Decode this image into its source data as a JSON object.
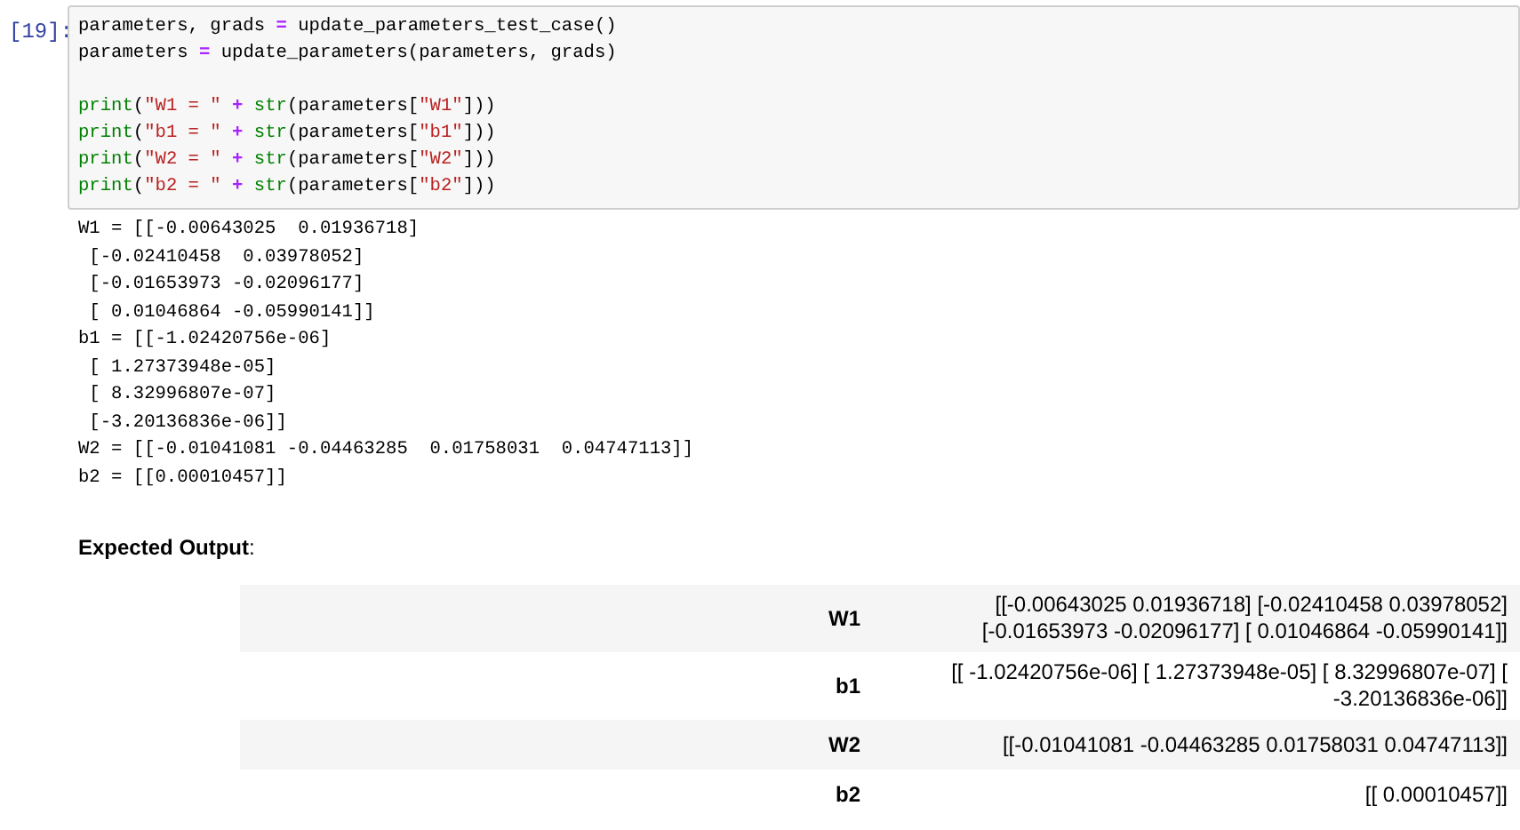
{
  "cell": {
    "prompt": "[19]:",
    "code_blocks": [
      [
        [
          {
            "kind": "name",
            "text": "parameters, grads "
          },
          {
            "kind": "op",
            "text": "="
          },
          {
            "kind": "name",
            "text": " update_parameters_test_case()"
          }
        ],
        [
          {
            "kind": "name",
            "text": "parameters "
          },
          {
            "kind": "op",
            "text": "="
          },
          {
            "kind": "name",
            "text": " update_parameters(parameters, grads)"
          }
        ]
      ],
      [
        [
          {
            "kind": "builtin",
            "text": "print"
          },
          {
            "kind": "name",
            "text": "("
          },
          {
            "kind": "string",
            "text": "\"W1 = \""
          },
          {
            "kind": "op",
            "text": " + "
          },
          {
            "kind": "builtin",
            "text": "str"
          },
          {
            "kind": "name",
            "text": "(parameters["
          },
          {
            "kind": "string",
            "text": "\"W1\""
          },
          {
            "kind": "name",
            "text": "]))"
          }
        ],
        [
          {
            "kind": "builtin",
            "text": "print"
          },
          {
            "kind": "name",
            "text": "("
          },
          {
            "kind": "string",
            "text": "\"b1 = \""
          },
          {
            "kind": "op",
            "text": " + "
          },
          {
            "kind": "builtin",
            "text": "str"
          },
          {
            "kind": "name",
            "text": "(parameters["
          },
          {
            "kind": "string",
            "text": "\"b1\""
          },
          {
            "kind": "name",
            "text": "]))"
          }
        ],
        [
          {
            "kind": "builtin",
            "text": "print"
          },
          {
            "kind": "name",
            "text": "("
          },
          {
            "kind": "string",
            "text": "\"W2 = \""
          },
          {
            "kind": "op",
            "text": " + "
          },
          {
            "kind": "builtin",
            "text": "str"
          },
          {
            "kind": "name",
            "text": "(parameters["
          },
          {
            "kind": "string",
            "text": "\"W2\""
          },
          {
            "kind": "name",
            "text": "]))"
          }
        ],
        [
          {
            "kind": "builtin",
            "text": "print"
          },
          {
            "kind": "name",
            "text": "("
          },
          {
            "kind": "string",
            "text": "\"b2 = \""
          },
          {
            "kind": "op",
            "text": " + "
          },
          {
            "kind": "builtin",
            "text": "str"
          },
          {
            "kind": "name",
            "text": "(parameters["
          },
          {
            "kind": "string",
            "text": "\"b2\""
          },
          {
            "kind": "name",
            "text": "]))"
          }
        ]
      ]
    ],
    "output_lines": [
      "W1 = [[-0.00643025  0.01936718]",
      " [-0.02410458  0.03978052]",
      " [-0.01653973 -0.02096177]",
      " [ 0.01046864 -0.05990141]]",
      "b1 = [[-1.02420756e-06]",
      " [ 1.27373948e-05]",
      " [ 8.32996807e-07]",
      " [-3.20136836e-06]]",
      "W2 = [[-0.01041081 -0.04463285  0.01758031  0.04747113]]",
      "b2 = [[0.00010457]]"
    ]
  },
  "expected": {
    "heading": "Expected Output",
    "colon": ":",
    "rows": [
      {
        "label": "W1",
        "value": "[[-0.00643025 0.01936718] [-0.02410458 0.03978052] [-0.01653973 -0.02096177] [ 0.01046864 -0.05990141]]"
      },
      {
        "label": "b1",
        "value": "[[ -1.02420756e-06] [ 1.27373948e-05] [ 8.32996807e-07] [ -3.20136836e-06]]"
      },
      {
        "label": "W2",
        "value": "[[-0.01041081 -0.04463285 0.01758031 0.04747113]]"
      },
      {
        "label": "b2",
        "value": "[[ 0.00010457]]"
      }
    ]
  }
}
